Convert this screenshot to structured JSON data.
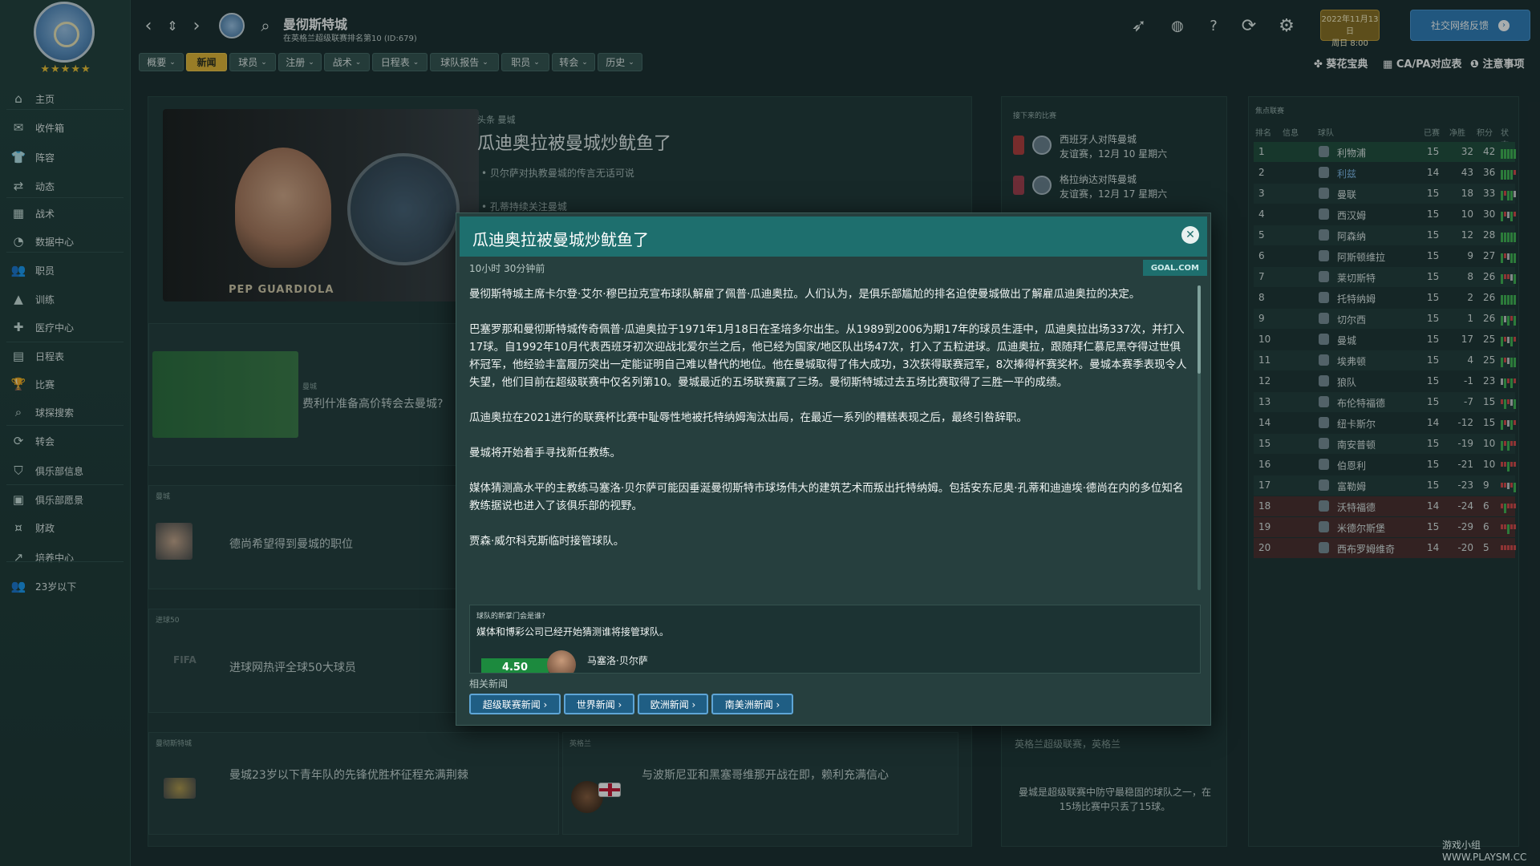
{
  "club": {
    "rating_stars": "★★★★★"
  },
  "sidebar": {
    "items": [
      {
        "label": "主页",
        "icon": "home-icon",
        "glyph": "⌂"
      },
      {
        "label": "收件箱",
        "icon": "inbox-icon",
        "glyph": "✉"
      },
      {
        "label": "阵容",
        "icon": "squad-icon",
        "glyph": "👕"
      },
      {
        "label": "动态",
        "icon": "dynamics-icon",
        "glyph": "⇄"
      },
      {
        "label": "战术",
        "icon": "tactics-icon",
        "glyph": "▦"
      },
      {
        "label": "数据中心",
        "icon": "data-hub-icon",
        "glyph": "◔"
      },
      {
        "label": "职员",
        "icon": "staff-icon",
        "glyph": "👥"
      },
      {
        "label": "训练",
        "icon": "training-icon",
        "glyph": "▲"
      },
      {
        "label": "医疗中心",
        "icon": "medical-icon",
        "glyph": "✚"
      },
      {
        "label": "日程表",
        "icon": "schedule-icon",
        "glyph": "▤"
      },
      {
        "label": "比赛",
        "icon": "trophy-icon",
        "glyph": "🏆"
      },
      {
        "label": "球探搜索",
        "icon": "scouting-icon",
        "glyph": "⌕"
      },
      {
        "label": "转会",
        "icon": "transfer-icon",
        "glyph": "⟳"
      },
      {
        "label": "俱乐部信息",
        "icon": "club-info-icon",
        "glyph": "⛉"
      },
      {
        "label": "俱乐部愿景",
        "icon": "club-vision-icon",
        "glyph": "▣"
      },
      {
        "label": "财政",
        "icon": "finance-icon",
        "glyph": "¤"
      },
      {
        "label": "培养中心",
        "icon": "development-icon",
        "glyph": "↗"
      },
      {
        "label": "23岁以下",
        "icon": "u23-icon",
        "glyph": "👥"
      }
    ]
  },
  "topbar": {
    "title": "曼彻斯特城",
    "subtitle": "在英格兰超级联赛排名第10 (ID:679)",
    "menu": [
      {
        "label": "概要",
        "chev": "⌄"
      },
      {
        "label": "新闻",
        "chev": ""
      },
      {
        "label": "球员",
        "chev": "⌄"
      },
      {
        "label": "注册",
        "chev": "⌄"
      },
      {
        "label": "战术",
        "chev": "⌄"
      },
      {
        "label": "日程表",
        "chev": "⌄"
      },
      {
        "label": "球队报告",
        "chev": "⌄"
      },
      {
        "label": "职员",
        "chev": "⌄"
      },
      {
        "label": "转会",
        "chev": "⌄"
      },
      {
        "label": "历史",
        "chev": "⌄"
      }
    ],
    "date_line1": "2022年11月13日",
    "date_line2": "周日 8:00",
    "continue_label": "社交网络反馈",
    "quick_links": [
      "葵花宝典",
      "CA/PA对应表",
      "注意事项"
    ]
  },
  "news": {
    "hero": {
      "tag": "头条  曼城",
      "title": "瓜迪奥拉被曼城炒鱿鱼了",
      "caption": "PEP GUARDIOLA",
      "bullets": [
        "贝尔萨对执教曼城的传言无话可说",
        "孔蒂持续关注曼城"
      ]
    },
    "cards": [
      {
        "tag": "曼城",
        "title": "费利什准备高价转会去曼城?"
      },
      {
        "tag": "曼城",
        "title": "德尚希望得到曼城的职位"
      },
      {
        "tag": "进球50",
        "title": "进球网热评全球50大球员",
        "thumb_text": "FIFA"
      },
      {
        "tag": "曼彻斯特城",
        "title": "曼城23岁以下青年队的先锋优胜杯征程充满荆棘"
      },
      {
        "tag": "英格兰",
        "title": "与波斯尼亚和黑塞哥维那开战在即，赖利充满信心"
      }
    ]
  },
  "upcoming": {
    "heading": "接下来的比赛",
    "fixtures": [
      {
        "teams": "西班牙人对阵曼城",
        "date": "友谊赛，12月 10 星期六"
      },
      {
        "teams": "格拉纳达对阵曼城",
        "date": "友谊赛，12月 17 星期六"
      }
    ],
    "league_note_tag": "英格兰超级联赛，英格兰",
    "league_note": "曼城是超级联赛中防守最稳固的球队之一，在15场比赛中只丢了15球。"
  },
  "league_table": {
    "heading": "焦点联赛",
    "columns": [
      "排名",
      "信息",
      "球队",
      "已赛",
      "净胜",
      "积分",
      "状态"
    ],
    "rows": [
      {
        "pos": "1",
        "team": "利物浦",
        "p": "15",
        "gd": "32",
        "pts": "42",
        "form": "WWWWW"
      },
      {
        "pos": "2",
        "team": "利兹",
        "p": "14",
        "gd": "43",
        "pts": "36",
        "form": "WWWWL"
      },
      {
        "pos": "3",
        "team": "曼联",
        "p": "15",
        "gd": "18",
        "pts": "33",
        "form": "WLWWD"
      },
      {
        "pos": "4",
        "team": "西汉姆",
        "p": "15",
        "gd": "10",
        "pts": "30",
        "form": "WLDWL"
      },
      {
        "pos": "5",
        "team": "阿森纳",
        "p": "15",
        "gd": "12",
        "pts": "28",
        "form": "WWWWW"
      },
      {
        "pos": "6",
        "team": "阿斯顿维拉",
        "p": "15",
        "gd": "9",
        "pts": "27",
        "form": "WLDWW"
      },
      {
        "pos": "7",
        "team": "莱切斯特",
        "p": "15",
        "gd": "8",
        "pts": "26",
        "form": "WLLDW"
      },
      {
        "pos": "8",
        "team": "托特纳姆",
        "p": "15",
        "gd": "2",
        "pts": "26",
        "form": "WWWWW"
      },
      {
        "pos": "9",
        "team": "切尔西",
        "p": "15",
        "gd": "1",
        "pts": "26",
        "form": "WDWLW"
      },
      {
        "pos": "10",
        "team": "曼城",
        "p": "15",
        "gd": "17",
        "pts": "25",
        "form": "WLDWL"
      },
      {
        "pos": "11",
        "team": "埃弗顿",
        "p": "15",
        "gd": "4",
        "pts": "25",
        "form": "WLDWW"
      },
      {
        "pos": "12",
        "team": "狼队",
        "p": "15",
        "gd": "-1",
        "pts": "23",
        "form": "DWLWL"
      },
      {
        "pos": "13",
        "team": "布伦特福德",
        "p": "15",
        "gd": "-7",
        "pts": "15",
        "form": "LWLDW"
      },
      {
        "pos": "14",
        "team": "纽卡斯尔",
        "p": "14",
        "gd": "-12",
        "pts": "15",
        "form": "WLDWL"
      },
      {
        "pos": "15",
        "team": "南安普顿",
        "p": "15",
        "gd": "-19",
        "pts": "10",
        "form": "WLWLL"
      },
      {
        "pos": "16",
        "team": "伯恩利",
        "p": "15",
        "gd": "-21",
        "pts": "10",
        "form": "LLWLL"
      },
      {
        "pos": "17",
        "team": "富勒姆",
        "p": "15",
        "gd": "-23",
        "pts": "9",
        "form": "LLDLW"
      },
      {
        "pos": "18",
        "team": "沃特福德",
        "p": "14",
        "gd": "-24",
        "pts": "6",
        "form": "LWLLL"
      },
      {
        "pos": "19",
        "team": "米德尔斯堡",
        "p": "15",
        "gd": "-29",
        "pts": "6",
        "form": "LLWLL"
      },
      {
        "pos": "20",
        "team": "西布罗姆维奇",
        "p": "14",
        "gd": "-20",
        "pts": "5",
        "form": "LLLLL"
      }
    ]
  },
  "modal": {
    "title": "瓜迪奥拉被曼城炒鱿鱼了",
    "time": "10小时 30分钟前",
    "source": "GOAL.COM",
    "paragraphs": [
      "曼彻斯特城主席卡尔登·艾尔·穆巴拉克宣布球队解雇了佩普·瓜迪奥拉。人们认为，是俱乐部尴尬的排名迫使曼城做出了解雇瓜迪奥拉的决定。",
      "巴塞罗那和曼彻斯特城传奇佩普·瓜迪奥拉于1971年1月18日在圣培多尔出生。从1989到2006为期17年的球员生涯中，瓜迪奥拉出场337次，并打入17球。自1992年10月代表西班牙初次迎战北爱尔兰之后，他已经为国家/地区队出场47次，打入了五粒进球。瓜迪奥拉，跟随拜仁慕尼黑夺得过世俱杯冠军，他经验丰富履历突出一定能证明自己难以替代的地位。他在曼城取得了伟大成功，3次获得联赛冠军，8次捧得杯赛奖杯。曼城本赛季表现令人失望，他们目前在超级联赛中仅名列第10。曼城最近的五场联赛赢了三场。曼彻斯特城过去五场比赛取得了三胜一平的成绩。",
      "瓜迪奥拉在2021进行的联赛杯比赛中耻辱性地被托特纳姆淘汰出局，在最近一系列的糟糕表现之后，最终引咎辞职。",
      "曼城将开始着手寻找新任教练。",
      "媒体猜测高水平的主教练马塞洛·贝尔萨可能因垂涎曼彻斯特市球场伟大的建筑艺术而叛出托特纳姆。包括安东尼奥·孔蒂和迪迪埃·德尚在内的多位知名教练据说也进入了该俱乐部的视野。",
      "贾森·威尔科克斯临时接管球队。"
    ],
    "poll_tag": "球队的新掌门会是谁?",
    "poll_text": "媒体和博彩公司已经开始猜测谁将接管球队。",
    "poll_odds": "4.50",
    "poll_name": "马塞洛·贝尔萨",
    "related_label": "相关新闻",
    "related": [
      "超级联赛新闻 ›",
      "世界新闻 ›",
      "欧洲新闻 ›",
      "南美洲新闻 ›"
    ]
  },
  "watermark": "游戏小组 WWW.PLAYSM.CC"
}
